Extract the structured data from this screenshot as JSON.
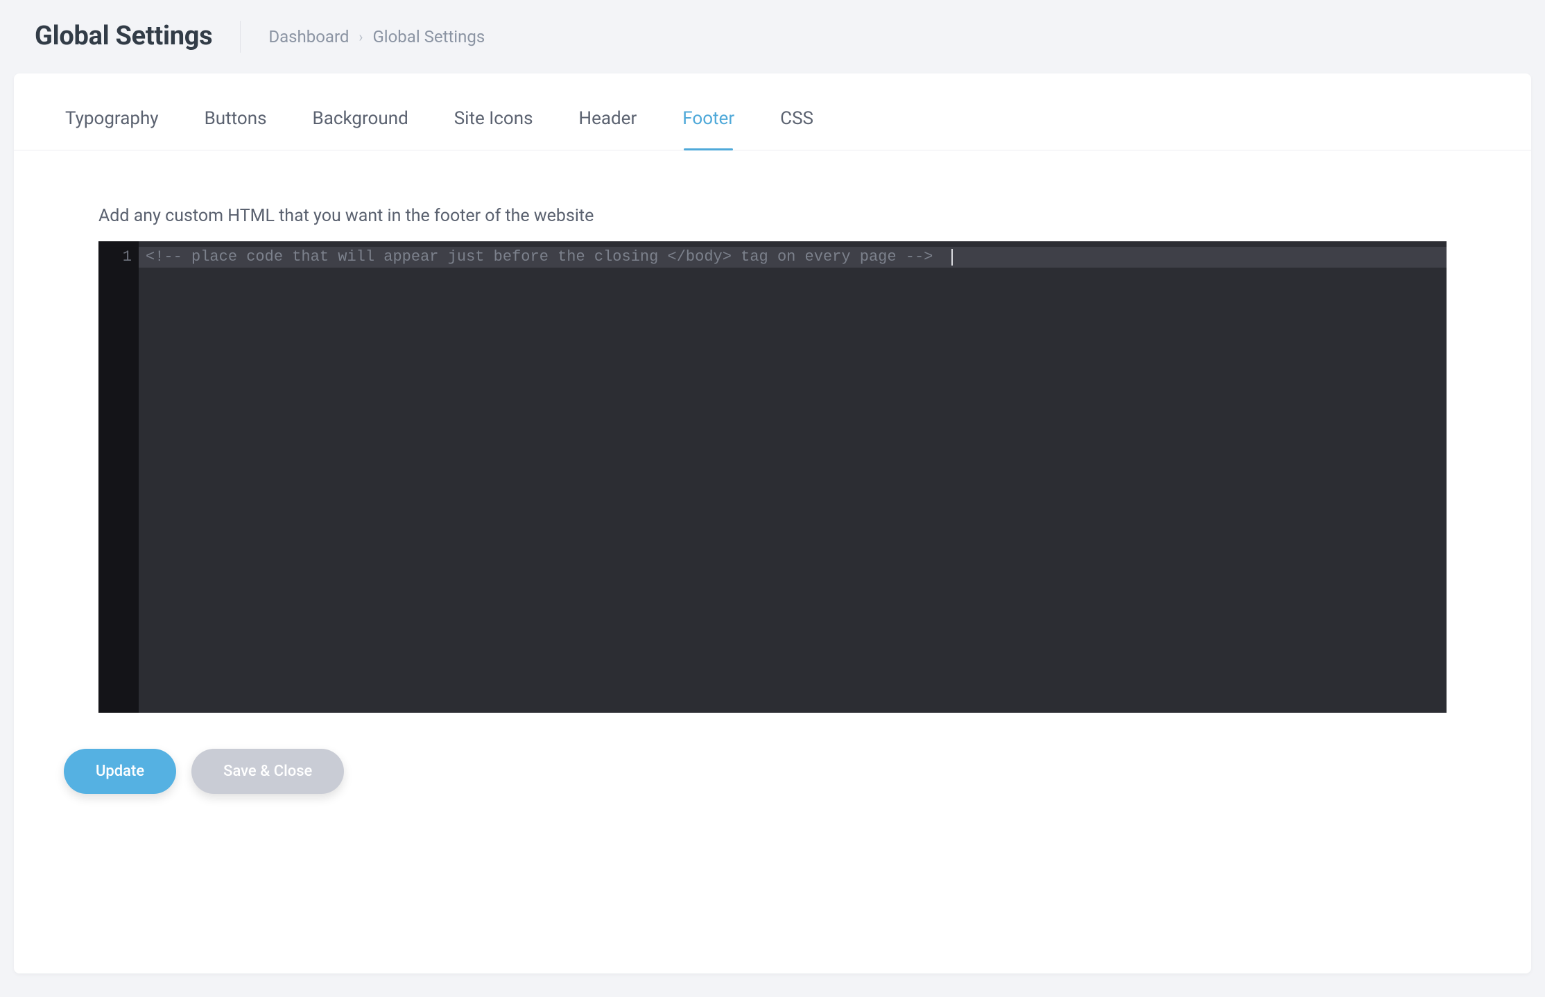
{
  "header": {
    "title": "Global Settings",
    "breadcrumbs": [
      {
        "label": "Dashboard"
      },
      {
        "label": "Global Settings"
      }
    ],
    "separator": "›"
  },
  "tabs": [
    {
      "id": "typography",
      "label": "Typography",
      "active": false
    },
    {
      "id": "buttons",
      "label": "Buttons",
      "active": false
    },
    {
      "id": "background",
      "label": "Background",
      "active": false
    },
    {
      "id": "site-icons",
      "label": "Site Icons",
      "active": false
    },
    {
      "id": "header",
      "label": "Header",
      "active": false
    },
    {
      "id": "footer",
      "label": "Footer",
      "active": true
    },
    {
      "id": "css",
      "label": "CSS",
      "active": false
    }
  ],
  "panel": {
    "description": "Add any custom HTML that you want in the footer of the website",
    "code": {
      "lines": [
        "<!-- place code that will appear just before the closing </body> tag on every page -->"
      ],
      "highlighted_line_index": 0,
      "cursor_col": 88
    }
  },
  "actions": {
    "update": "Update",
    "save_close": "Save & Close"
  }
}
